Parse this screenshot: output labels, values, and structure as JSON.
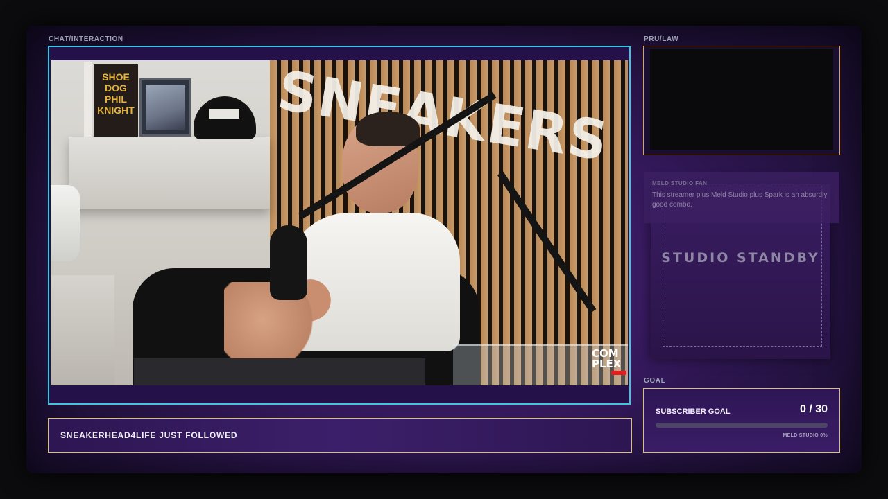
{
  "labels": {
    "chat": "CHAT/INTERACTION",
    "prulaw": "PRU/LAW",
    "goal": "GOAL"
  },
  "video": {
    "sign_text": "SNEAKERS",
    "book_title": "SHOE DOG PHIL KNIGHT",
    "watermark": "COM PLEX"
  },
  "alert": {
    "text": "SNEAKERHEAD4LIFE JUST FOLLOWED"
  },
  "chat_message": {
    "user": "MELD STUDIO FAN",
    "body": "This streamer plus Meld Studio plus Spark is an absurdly good combo."
  },
  "standby": {
    "text": "STUDIO STANDBY"
  },
  "goal": {
    "title": "SUBSCRIBER GOAL",
    "count": "0 / 30",
    "progress_fraction": 0,
    "sub": "MELD STUDIO 0%"
  },
  "colors": {
    "video_border": "#38c9e0",
    "gold_border": "#d9c26a",
    "cam_border": "#d9a35a",
    "panel_purple": "#33185a"
  }
}
